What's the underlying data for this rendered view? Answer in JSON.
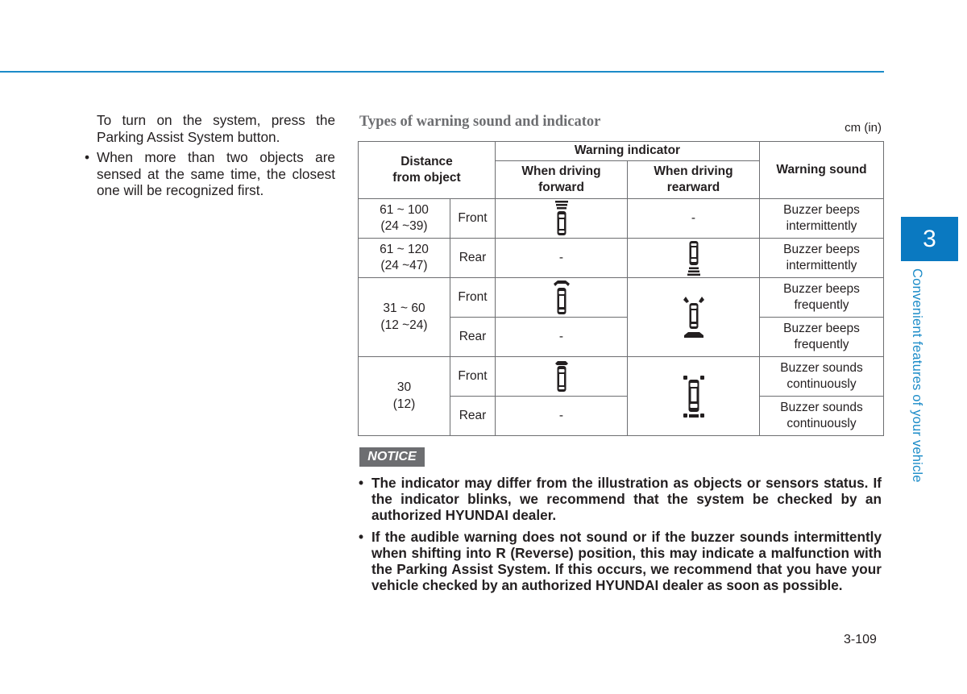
{
  "left_column": {
    "intro": "To turn on the system, press the Parking Assist System button.",
    "bullet_char": "•",
    "bullet": "When more than two objects are sensed at the same time, the closest one will be recognized first."
  },
  "table_section": {
    "title": "Types of warning sound and indicator",
    "units": "cm (in)",
    "headers": {
      "distance": "Distance from object",
      "warning_indicator": "Warning indicator",
      "forward": "When driving forward",
      "rearward": "When driving rearward",
      "sound": "Warning sound"
    },
    "rows": [
      {
        "distance": "61 ~ 100",
        "distance_in": "(24 ~39)",
        "position": "Front",
        "forward_icon": "car-front-far-icon",
        "rearward": "-",
        "sound": "Buzzer beeps intermittently"
      },
      {
        "distance": "61 ~ 120",
        "distance_in": "(24 ~47)",
        "position": "Rear",
        "forward": "-",
        "rearward_icon": "car-rear-far-icon",
        "sound": "Buzzer beeps intermittently"
      },
      {
        "distance": "31 ~ 60",
        "distance_in": "(12 ~24)",
        "position": "Front",
        "forward_icon": "car-front-mid-icon",
        "rearward_icon": "car-all-mid-icon",
        "sound": "Buzzer beeps frequently"
      },
      {
        "position": "Rear",
        "forward": "-",
        "sound": "Buzzer beeps frequently"
      },
      {
        "distance": "30",
        "distance_in": "(12)",
        "position": "Front",
        "forward_icon": "car-front-near-icon",
        "rearward_icon": "car-all-near-icon",
        "sound": "Buzzer sounds continuously"
      },
      {
        "position": "Rear",
        "forward": "-",
        "sound": "Buzzer sounds continuously"
      }
    ]
  },
  "notice": {
    "label": "NOTICE",
    "bullet_char": "•",
    "items": [
      "The indicator may differ from the illustration as objects or sensors status. If the indicator blinks, we recommend that the system be checked by an authorized HYUNDAI dealer.",
      "If the audible warning does not sound or if the buzzer sounds intermittently when shifting into R (Reverse) position, this may indicate a malfunction with the Parking Assist System. If this occurs, we recommend that you have your vehicle checked by an authorized HYUNDAI dealer as soon as possible."
    ]
  },
  "sidebar": {
    "chapter_number": "3",
    "chapter_title": "Convenient features of your vehicle"
  },
  "page_number": "3-109",
  "colors": {
    "accent_blue": "#0a79c1",
    "rule_blue": "#1b8bc8",
    "notice_gray": "#6d6e71",
    "title_gray": "#6d6e71"
  }
}
